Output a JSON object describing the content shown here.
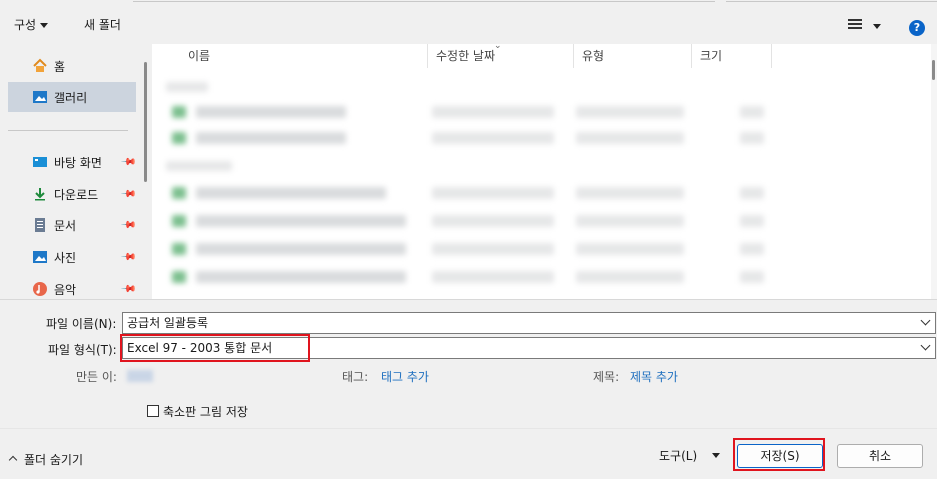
{
  "toolbar": {
    "organize_label": "구성",
    "new_folder_label": "새 폴더",
    "help_label": "?"
  },
  "nav": {
    "items": [
      {
        "label": "홈",
        "icon": "home-icon"
      },
      {
        "label": "갤러리",
        "icon": "gallery-icon",
        "selected": true
      },
      {
        "label": "바탕 화면",
        "icon": "desktop-icon",
        "pinned": true
      },
      {
        "label": "다운로드",
        "icon": "download-icon",
        "pinned": true
      },
      {
        "label": "문서",
        "icon": "document-icon",
        "pinned": true
      },
      {
        "label": "사진",
        "icon": "pictures-icon",
        "pinned": true
      },
      {
        "label": "음악",
        "icon": "music-icon",
        "pinned": true
      }
    ]
  },
  "list": {
    "columns": [
      "이름",
      "수정한 날짜",
      "유형",
      "크기"
    ]
  },
  "form": {
    "filename_label": "파일 이름(N):",
    "filename_value": "공급처 일괄등록",
    "filetype_label": "파일 형식(T):",
    "filetype_value": "Excel 97 - 2003 통합 문서",
    "author_label": "만든 이:",
    "tags_label": "태그:",
    "tags_value": "태그 추가",
    "title_label": "제목:",
    "title_value": "제목 추가",
    "thumbnail_label": "축소판 그림 저장"
  },
  "footer": {
    "hide_folders_label": "폴더 숨기기",
    "tools_label": "도구(L)",
    "save_label": "저장(S)",
    "cancel_label": "취소"
  },
  "colors": {
    "accent": "#0a64c8",
    "highlight_box": "#e0141e",
    "selected_nav": "#ccd4de"
  }
}
